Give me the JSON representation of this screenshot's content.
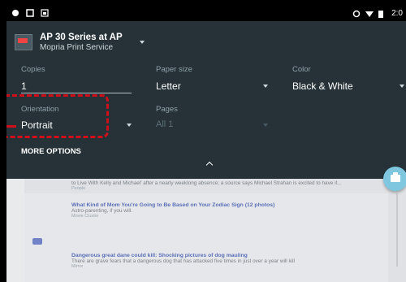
{
  "status_bar": {
    "time": "2:0",
    "left_icons": [
      "notification-icon",
      "screenshot-icon",
      "image-icon"
    ],
    "right_icons": [
      "sync-icon",
      "wifi-icon",
      "battery-icon"
    ]
  },
  "printer": {
    "name": "AP 30 Series at AP",
    "service": "Mopria Print Service"
  },
  "fields": {
    "copies": {
      "label": "Copies",
      "value": "1"
    },
    "paper_size": {
      "label": "Paper size",
      "value": "Letter"
    },
    "color": {
      "label": "Color",
      "value": "Black & White"
    },
    "orientation": {
      "label": "Orientation",
      "value": "Portrait"
    },
    "pages": {
      "label": "Pages",
      "value": "All 1"
    }
  },
  "more_options": "MORE OPTIONS",
  "feed": {
    "snippet1": "to Live With Kelly and Michael' after a nearly weeklong absence; a source says Michael Strahan is excited to have it...",
    "snippet1_source": "People",
    "article2_headline": "What Kind of Mom You're Going to Be Based on Your Zodiac Sign (12 photos)",
    "article2_desc": "Astro-parenting, if you will.",
    "article2_source": "Movie Cluster",
    "article3_headline": "Dangerous great dane could kill: Shocking pictures of dog mauling",
    "article3_desc": "There are grave fears that a dangerous dog that has attacked five times in just over a year will kill",
    "article3_source": "Mirror"
  },
  "colors": {
    "panel": "#263238",
    "accent_dash": "#d10f1a",
    "fab": "#7fc7df"
  }
}
